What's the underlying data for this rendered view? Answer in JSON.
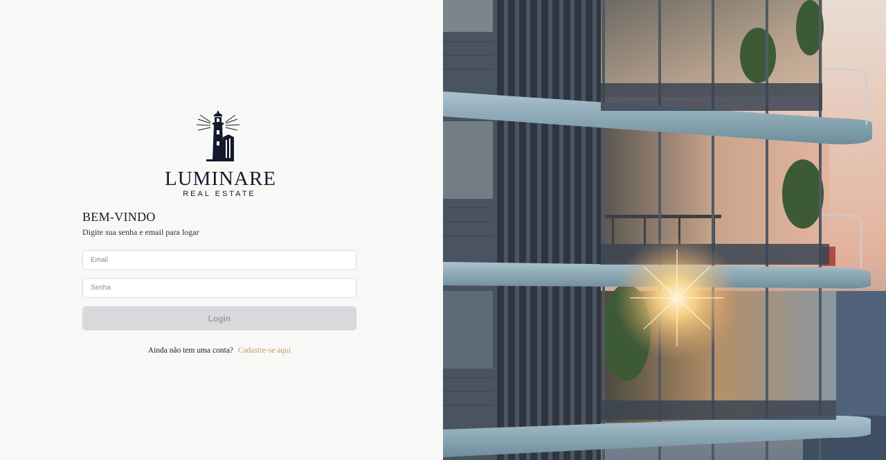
{
  "brand": {
    "name": "LUMINARE",
    "tagline": "REAL ESTATE",
    "primary_color": "#15192b",
    "accent_color": "#c49a63"
  },
  "login": {
    "title": "BEM-VINDO",
    "subtitle": "Digite sua senha e email para logar",
    "email_placeholder": "Email",
    "email_value": "",
    "password_placeholder": "Senha",
    "password_value": "",
    "button_label": "Login",
    "button_state": "disabled"
  },
  "signup": {
    "prompt": "Ainda não tem uma conta?",
    "link_label": "Cadastre-se aqui"
  },
  "hero": {
    "icon": "building-sunset-photo"
  }
}
